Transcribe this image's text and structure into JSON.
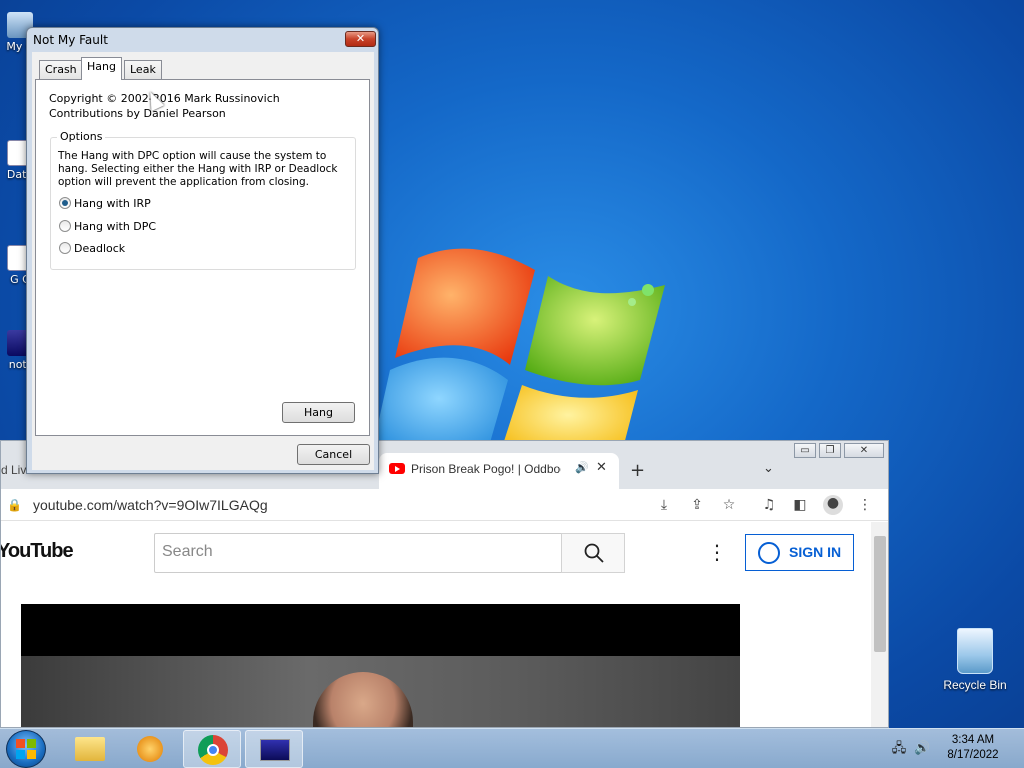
{
  "desktop": {
    "icons": [
      {
        "label": "My C"
      },
      {
        "label": "Data"
      },
      {
        "label": "G\nC"
      },
      {
        "label": "notr"
      }
    ],
    "recycle_bin_label": "Recycle Bin"
  },
  "dialog": {
    "title": "Not My Fault",
    "close_glyph": "✕",
    "tabs": [
      {
        "label": "Crash",
        "active": false
      },
      {
        "label": "Hang",
        "active": true
      },
      {
        "label": "Leak",
        "active": false
      }
    ],
    "copyright": "Copyright © 2002-2016 Mark Russinovich",
    "contributions": "Contributions by Daniel Pearson",
    "options_legend": "Options",
    "description": "The Hang with DPC option will cause the system to hang. Selecting either the Hang with IRP or Deadlock option will prevent the application from closing.",
    "radios": [
      {
        "label": "Hang with IRP",
        "selected": true
      },
      {
        "label": "Hang with DPC",
        "selected": false
      },
      {
        "label": "Deadlock",
        "selected": false
      }
    ],
    "hang_button": "Hang",
    "cancel_button": "Cancel"
  },
  "browser": {
    "left_tab_fragment": "d Liv",
    "tab_title": "Prison Break Pogo! | Oddbod",
    "url": "youtube.com/watch?v=9OIw7ILGAQg",
    "logo_text": "YouTube",
    "search_placeholder": "Search",
    "sign_in": "SIGN IN",
    "window_controls": [
      "▭",
      "❐",
      "✕"
    ]
  },
  "taskbar": {
    "time": "3:34 AM",
    "date": "8/17/2022"
  },
  "colors": {
    "youtube_red": "#ff0000",
    "signin_blue": "#065fd4",
    "desktop_blue": "#1468c8"
  }
}
